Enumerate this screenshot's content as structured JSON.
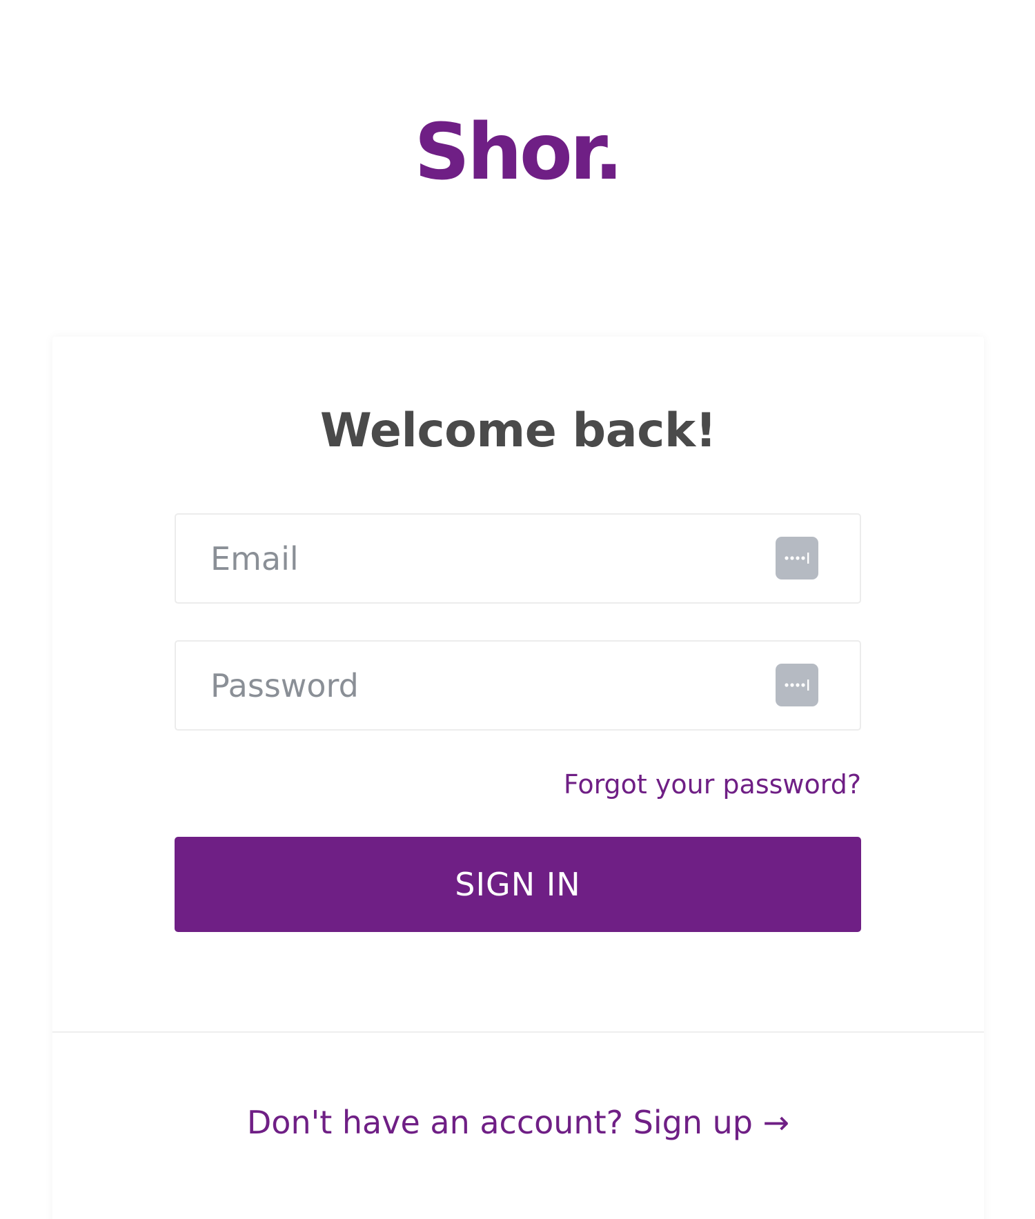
{
  "colors": {
    "brand": "#6f1f85",
    "heading": "#4a4a4a",
    "placeholder": "#8a8f96",
    "icon_bg": "#b5bac2"
  },
  "logo": {
    "text": "Shor."
  },
  "login": {
    "heading": "Welcome back!",
    "email": {
      "placeholder": "Email",
      "value": "",
      "icon": "password-manager-icon"
    },
    "password": {
      "placeholder": "Password",
      "value": "",
      "icon": "password-manager-icon"
    },
    "forgot_link": "Forgot your password?",
    "submit_label": "SIGN IN"
  },
  "footer": {
    "signup_link": "Don't have an account? Sign up →"
  }
}
